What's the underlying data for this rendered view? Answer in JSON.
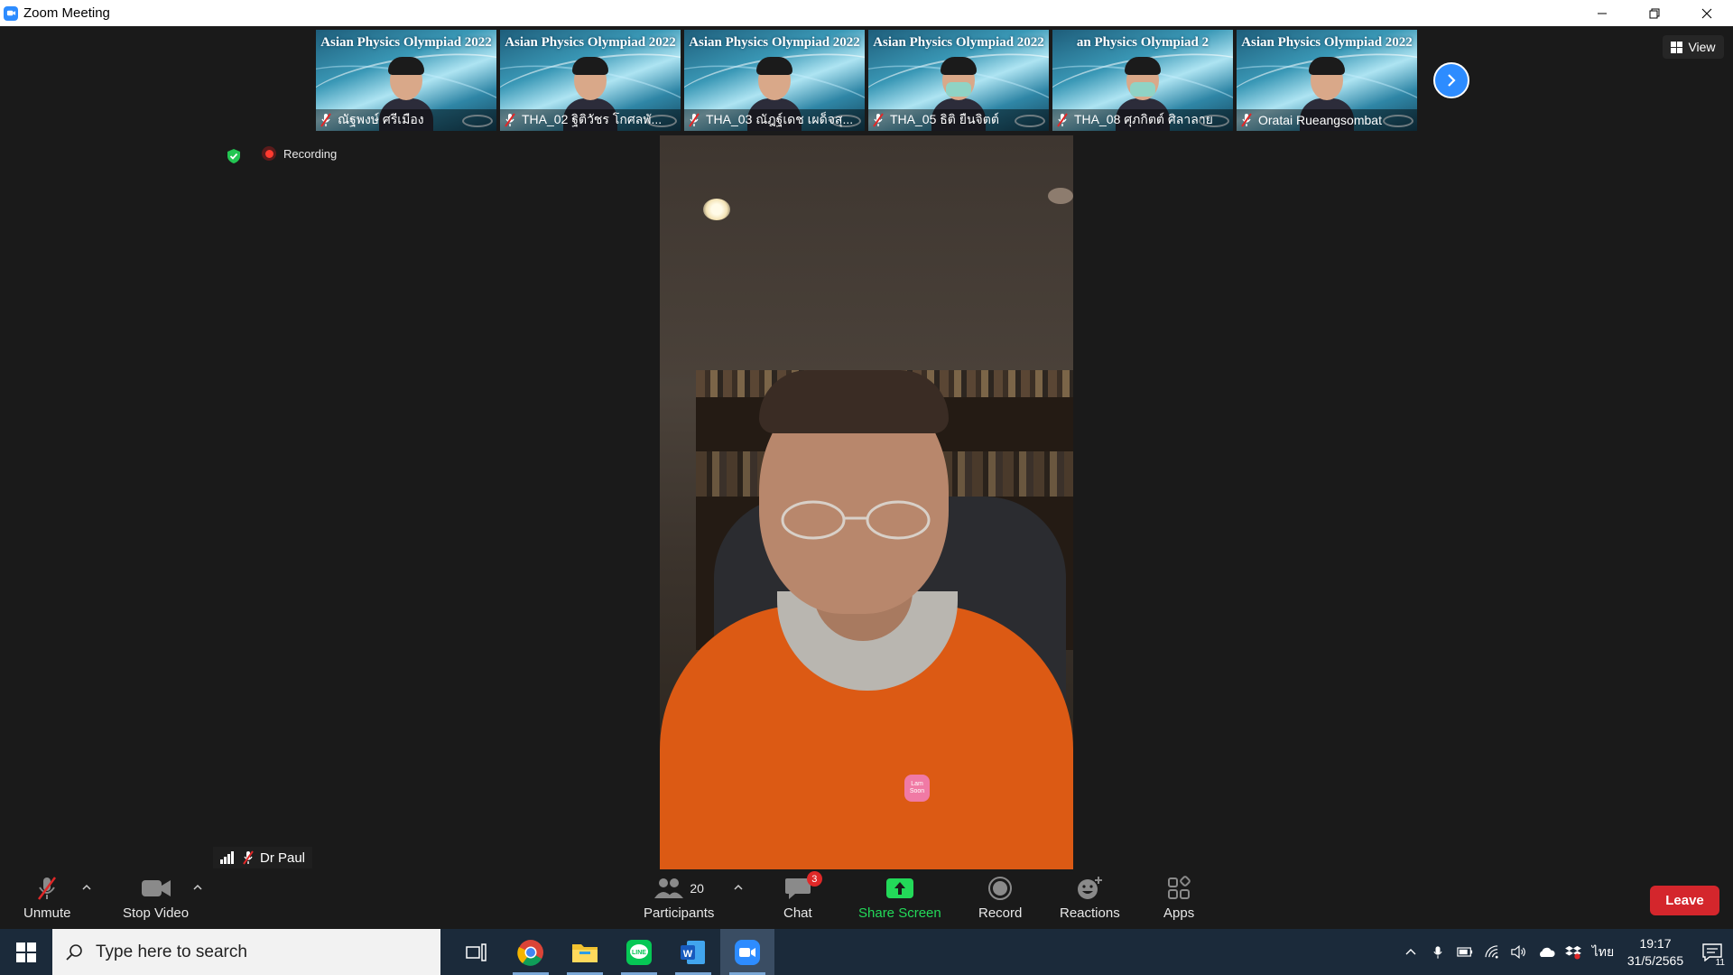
{
  "window": {
    "title": "Zoom Meeting"
  },
  "thumbnails": {
    "banner_text": "Asian Physics Olympiad 2022",
    "participants": [
      {
        "name": "ณัฐพงษ์ ศรีเมือง",
        "muted": true,
        "masked": false
      },
      {
        "name": "THA_02 ฐิติวัชร โกศลพั...",
        "muted": true,
        "masked": false
      },
      {
        "name": "THA_03 ณัฎฐ์เดช เผด็จสุ...",
        "muted": true,
        "masked": false
      },
      {
        "name": "THA_05 ธิติ ยืนจิตต์",
        "muted": true,
        "masked": true
      },
      {
        "name": "THA_08 ศุภกิตต์ ศิลาลาย",
        "muted": true,
        "masked": true
      },
      {
        "name": "Oratai Rueangsombat",
        "muted": true,
        "masked": false
      }
    ],
    "truncated_banner": "an Physics Olympiad 2"
  },
  "view_button": {
    "label": "View"
  },
  "recording": {
    "label": "Recording"
  },
  "speaker": {
    "name": "Dr Paul",
    "shirt_badge": "Lam Soon"
  },
  "toolbar": {
    "unmute_label": "Unmute",
    "stop_video_label": "Stop Video",
    "participants_label": "Participants",
    "participants_count": "20",
    "chat_label": "Chat",
    "chat_badge": "3",
    "share_label": "Share Screen",
    "record_label": "Record",
    "reactions_label": "Reactions",
    "apps_label": "Apps",
    "leave_label": "Leave"
  },
  "taskbar": {
    "search_placeholder": "Type here to search",
    "language": "ไทย",
    "time": "19:17",
    "date": "31/5/2565",
    "notification_count": "11"
  },
  "colors": {
    "accent": "#2d8cff",
    "share_green": "#23d959",
    "leave_red": "#d4262c",
    "taskbar": "#1b2a3a"
  }
}
